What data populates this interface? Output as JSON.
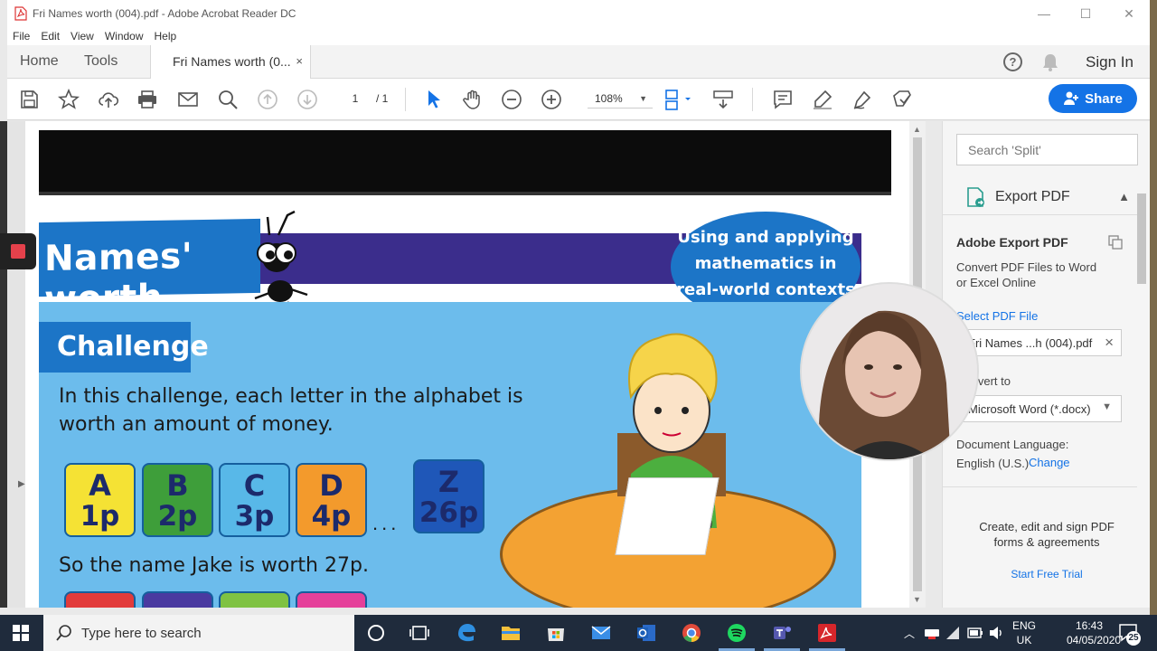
{
  "window": {
    "title": "Fri Names worth (004).pdf - Adobe Acrobat Reader DC",
    "min_glyph": "—",
    "max_glyph": "☐",
    "close_glyph": "✕"
  },
  "menu": [
    "File",
    "Edit",
    "View",
    "Window",
    "Help"
  ],
  "tabs": {
    "home": "Home",
    "tools": "Tools",
    "document": "Fri Names worth (0...",
    "close_glyph": "×",
    "help_glyph": "?",
    "sign_in": "Sign In"
  },
  "toolbar": {
    "page_current": "1",
    "page_total": "/ 1",
    "zoom": "108%",
    "zoom_caret": "▼",
    "share_label": "Share"
  },
  "document": {
    "title": "Names' worth",
    "bubble_lines": [
      "Using and applying",
      "mathematics in",
      "real-world contexts"
    ],
    "challenge_label": "Challenge",
    "intro_lines": [
      "In this challenge, each letter in the alphabet is",
      "worth an amount of money."
    ],
    "letters": [
      {
        "letter": "A",
        "value": "1p",
        "color": "#f5e234"
      },
      {
        "letter": "B",
        "value": "2p",
        "color": "#3e9e3a"
      },
      {
        "letter": "C",
        "value": "3p",
        "color": "#58b8e8"
      },
      {
        "letter": "D",
        "value": "4p",
        "color": "#f39a2c"
      },
      {
        "letter": "Z",
        "value": "26p",
        "color": "#1f57b8"
      }
    ],
    "ellipsis": "...",
    "example_text": "So the name Jake is worth 27p."
  },
  "sidebar": {
    "search_placeholder": "Search 'Split'",
    "export_label": "Export PDF",
    "export_caret": "▲",
    "heading": "Adobe Export PDF",
    "description_lines": [
      "Convert PDF Files to Word",
      "or Excel Online"
    ],
    "select_file": "Select PDF File",
    "file_name": "Fri Names ...h (004).pdf",
    "file_clear": "×",
    "convert_to": "Convert to",
    "format": "Microsoft Word (*.docx)",
    "format_caret": "▼",
    "language_label": "Document Language:",
    "language_value": "English (U.S.)",
    "change_link": "Change",
    "promo_lines": [
      "Create, edit and sign PDF",
      "forms & agreements"
    ],
    "trial_link": "Start Free Trial"
  },
  "taskbar": {
    "search_placeholder": "Type here to search",
    "lang_top": "ENG",
    "lang_bottom": "UK",
    "time": "16:43",
    "date": "04/05/2020",
    "notification_count": "25"
  },
  "colors": {
    "accent": "#1473e6",
    "doc_blue": "#1c75c7",
    "doc_purple": "#3b2d8c",
    "panel_blue": "#6cbcec"
  }
}
